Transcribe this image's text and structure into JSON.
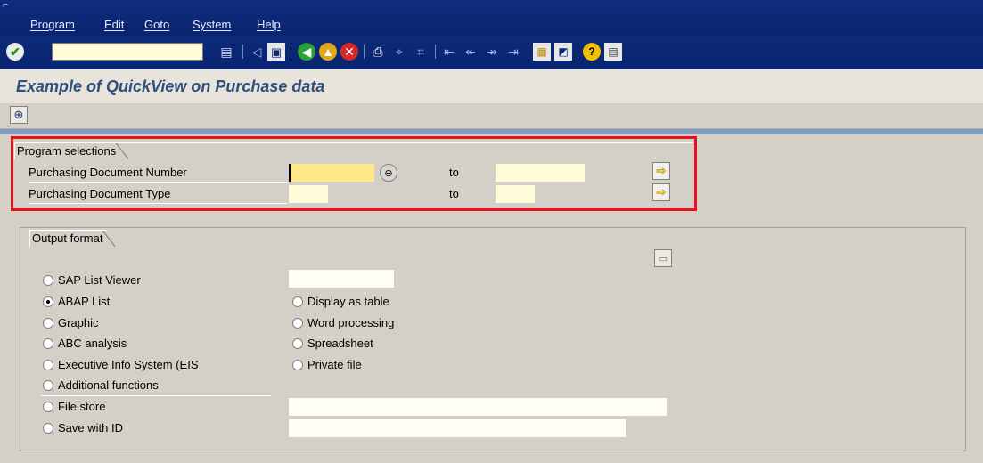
{
  "menu": {
    "items": [
      "Program",
      "Edit",
      "Goto",
      "System",
      "Help"
    ]
  },
  "toolbar": {
    "command_field": {
      "value": "",
      "placeholder": ""
    },
    "icons": [
      "enter-icon",
      "save-icon",
      "back-icon",
      "exit-icon",
      "cancel-icon",
      "print-icon",
      "find-icon",
      "find-next-icon",
      "first-page-icon",
      "previous-page-icon",
      "next-page-icon",
      "last-page-icon",
      "create-session-icon",
      "shortcut-icon",
      "help-icon",
      "layout-menu-icon"
    ]
  },
  "header": {
    "title": "Example of QuickView on Purchase data"
  },
  "app_toolbar": {
    "execute_icon": "execute-icon"
  },
  "program_selections": {
    "title": "Program selections",
    "rows": [
      {
        "label": "Purchasing Document Number",
        "from": "",
        "to_label": "to",
        "to": ""
      },
      {
        "label": "Purchasing Document Type",
        "from": "",
        "to_label": "to",
        "to": ""
      }
    ]
  },
  "output_format": {
    "title": "Output format",
    "left_options": [
      {
        "label": "SAP List Viewer",
        "checked": false
      },
      {
        "label": "ABAP List",
        "checked": true
      },
      {
        "label": "Graphic",
        "checked": false
      },
      {
        "label": "ABC analysis",
        "checked": false
      },
      {
        "label": "Executive Info System (EIS",
        "checked": false
      },
      {
        "label": "Additional functions",
        "checked": false
      },
      {
        "label": "File store",
        "checked": false
      },
      {
        "label": "Save with ID",
        "checked": false
      }
    ],
    "right_options": [
      {
        "label": "Display as table",
        "checked": false
      },
      {
        "label": "Word processing",
        "checked": false
      },
      {
        "label": "Spreadsheet",
        "checked": false
      },
      {
        "label": "Private file",
        "checked": false
      }
    ]
  },
  "colors": {
    "menubar": "#0e2d7c",
    "title_text": "#2f4f7e",
    "highlight_border": "#e8101a",
    "input_bg": "#fffcda",
    "focused_input_bg": "#ffe88a"
  }
}
